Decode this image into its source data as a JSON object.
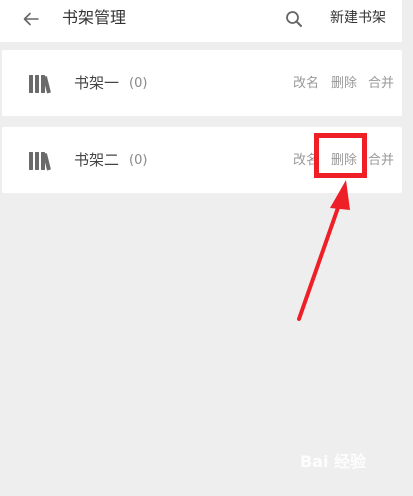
{
  "header": {
    "title": "书架管理",
    "new_shelf_label": "新建书架",
    "back_icon": "back-arrow-icon",
    "search_icon": "search-icon"
  },
  "shelves": [
    {
      "name": "书架一",
      "count": "(0)",
      "rename": "改名",
      "delete": "删除",
      "merge": "合并"
    },
    {
      "name": "书架二",
      "count": "(0)",
      "rename": "改名",
      "delete": "删除",
      "merge": "合并"
    }
  ],
  "annotation": {
    "color": "#ee1f26"
  },
  "watermark": {
    "text": "Bai 经验"
  }
}
